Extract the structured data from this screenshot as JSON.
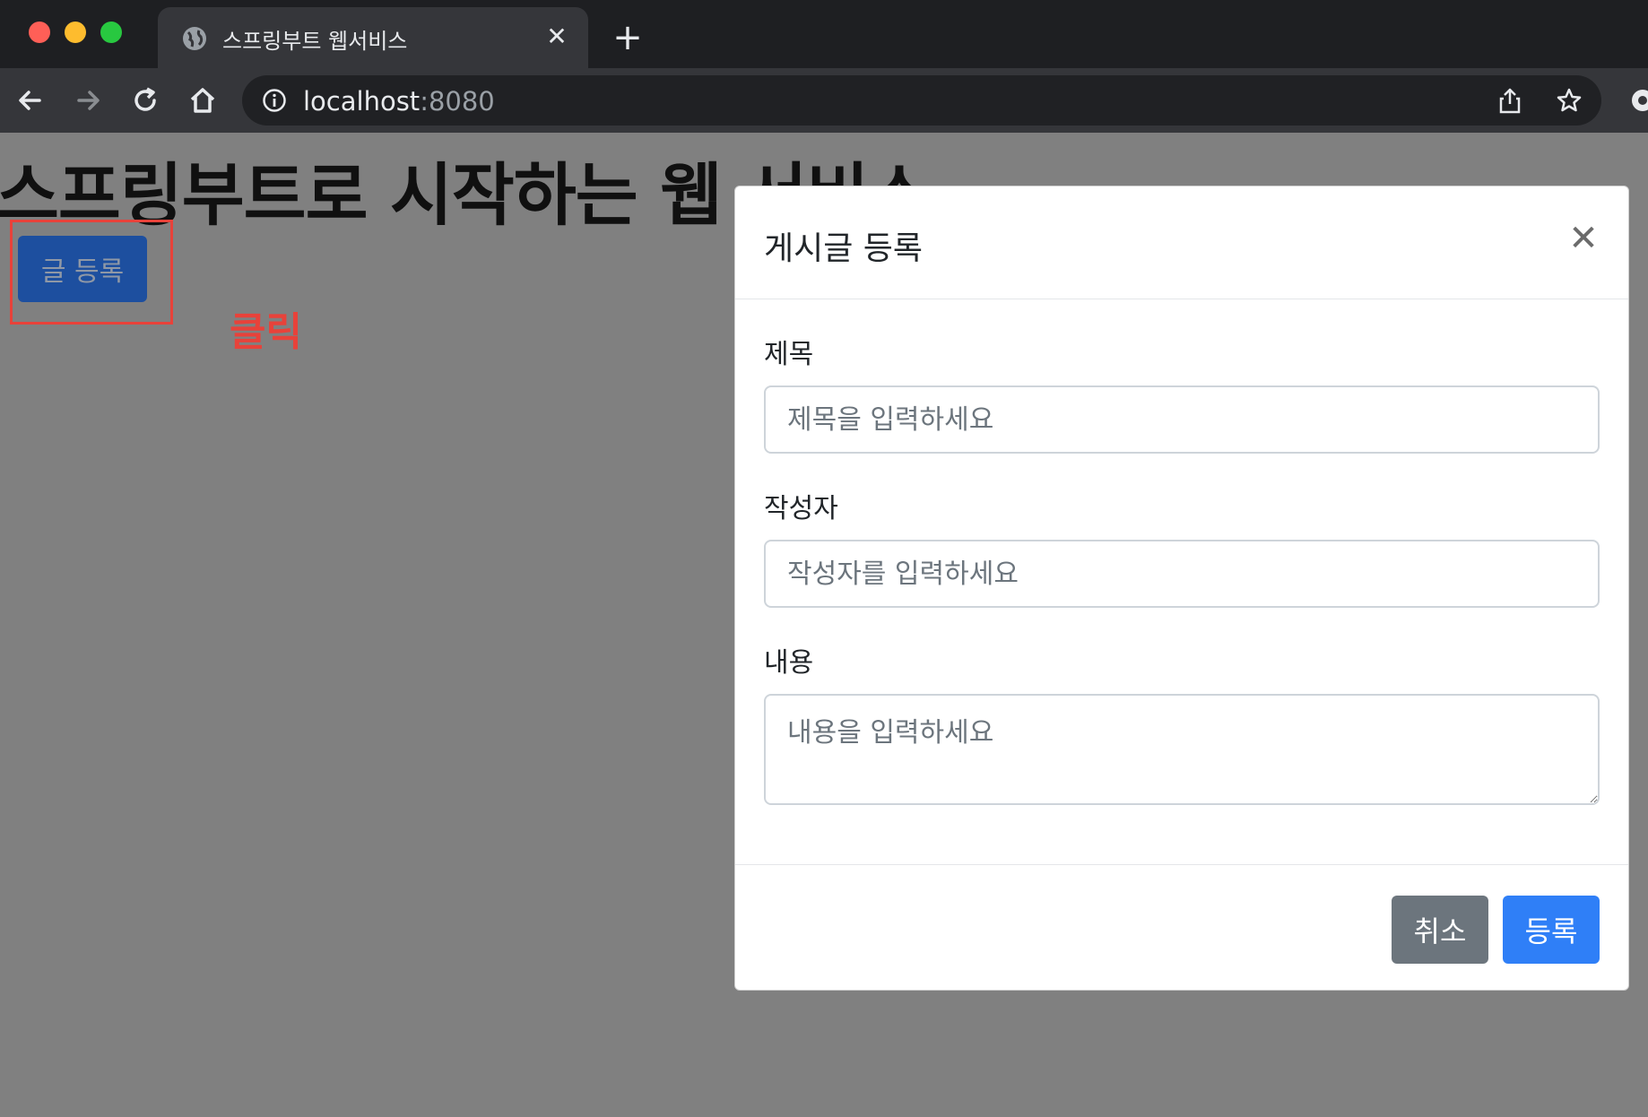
{
  "browser": {
    "tab_title": "스프링부트 웹서비스",
    "url_host": "localhost",
    "url_port": ":8080",
    "icons": {
      "tab_favicon": "globe-icon",
      "tab_close": "close-icon",
      "new_tab": "plus-icon",
      "back": "back-arrow-icon",
      "forward": "forward-arrow-icon",
      "reload": "reload-icon",
      "home": "home-icon",
      "site_info": "info-icon",
      "share": "share-icon",
      "bookmark": "star-icon",
      "extension": "gear-icon"
    }
  },
  "page": {
    "heading": "스프링부트로 시작하는 웹 서비스",
    "post_button_label": "글 등록",
    "annotation_label": "클릭",
    "annotation_color": "#e8423a"
  },
  "modal": {
    "title": "게시글 등록",
    "close_glyph": "✕",
    "fields": {
      "title": {
        "label": "제목",
        "placeholder": "제목을 입력하세요"
      },
      "author": {
        "label": "작성자",
        "placeholder": "작성자를 입력하세요"
      },
      "content": {
        "label": "내용",
        "placeholder": "내용을 입력하세요"
      }
    },
    "cancel_label": "취소",
    "submit_label": "등록",
    "colors": {
      "cancel": "#6c757d",
      "submit": "#2f7ff7"
    }
  }
}
